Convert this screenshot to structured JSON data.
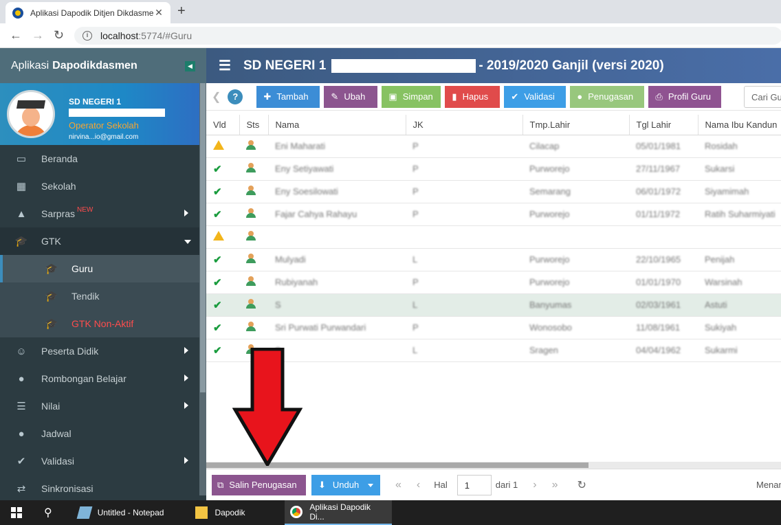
{
  "browser": {
    "tab_title": "Aplikasi Dapodik Ditjen Dikdasmen",
    "tab_close": "✕",
    "new_tab": "+",
    "url_host": "localhost",
    "url_path": ":5774/#Guru"
  },
  "sidebar": {
    "app_prefix": "Aplikasi",
    "app_name": "Dapodikdasmen",
    "profile": {
      "school": "SD NEGERI 1",
      "role": "Operator Sekolah",
      "email": "nirvina...io@gmail.com"
    },
    "items": [
      {
        "label": "Beranda",
        "icon": "desktop-icon"
      },
      {
        "label": "Sekolah",
        "icon": "building-icon"
      },
      {
        "label": "Sarpras",
        "badge": "NEW",
        "icon": "road-icon"
      },
      {
        "label": "GTK",
        "icon": "graduation-cap-icon"
      },
      {
        "label": "Guru",
        "icon": "graduation-cap-icon"
      },
      {
        "label": "Tendik",
        "icon": "graduation-cap-icon"
      },
      {
        "label": "GTK Non-Aktif",
        "icon": "graduation-cap-icon"
      },
      {
        "label": "Peserta Didik",
        "icon": "smile-icon"
      },
      {
        "label": "Rombongan Belajar",
        "icon": "users-icon"
      },
      {
        "label": "Nilai",
        "icon": "list-icon"
      },
      {
        "label": "Jadwal",
        "icon": "users-icon"
      },
      {
        "label": "Validasi",
        "icon": "check-icon"
      },
      {
        "label": "Sinkronisasi",
        "icon": "exchange-icon"
      }
    ]
  },
  "header": {
    "school": "SD NEGERI 1",
    "period": "- 2019/2020 Ganjil (versi 2020)"
  },
  "toolbar": {
    "help": "?",
    "tambah": "Tambah",
    "ubah": "Ubah",
    "simpan": "Simpan",
    "hapus": "Hapus",
    "validasi": "Validasi",
    "penugasan": "Penugasan",
    "profil_guru": "Profil Guru",
    "search_placeholder": "Cari Gu"
  },
  "table": {
    "headers": [
      "Vld",
      "Sts",
      "Nama",
      "JK",
      "Tmp.Lahir",
      "Tgl Lahir",
      "Nama Ibu Kandun"
    ],
    "rows": [
      {
        "vld": "warn",
        "nama": "Eni Maharati",
        "jk": "P",
        "tmp": "Cilacap",
        "tgl": "05/01/1981",
        "ibu": "Rosidah"
      },
      {
        "vld": "ok",
        "nama": "Eny Setiyawati",
        "jk": "P",
        "tmp": "Purworejo",
        "tgl": "27/11/1967",
        "ibu": "Sukarsi"
      },
      {
        "vld": "ok",
        "nama": "Eny Soesilowati",
        "jk": "P",
        "tmp": "Semarang",
        "tgl": "06/01/1972",
        "ibu": "Siyamimah"
      },
      {
        "vld": "ok",
        "nama": "Fajar Cahya Rahayu",
        "jk": "P",
        "tmp": "Purworejo",
        "tgl": "01/11/1972",
        "ibu": "Ratih Suharmiyati"
      },
      {
        "vld": "warn",
        "nama": "",
        "jk": "",
        "tmp": "",
        "tgl": "",
        "ibu": ""
      },
      {
        "vld": "ok",
        "nama": "Mulyadi",
        "jk": "L",
        "tmp": "Purworejo",
        "tgl": "22/10/1965",
        "ibu": "Penijah"
      },
      {
        "vld": "ok",
        "nama": "Rubiyanah",
        "jk": "P",
        "tmp": "Purworejo",
        "tgl": "01/01/1970",
        "ibu": "Warsinah"
      },
      {
        "vld": "ok",
        "nama": "S",
        "jk": "L",
        "tmp": "Banyumas",
        "tgl": "02/03/1961",
        "ibu": "Astuti"
      },
      {
        "vld": "ok",
        "nama": "Sri Purwati Purwandari",
        "jk": "P",
        "tmp": "Wonosobo",
        "tgl": "11/08/1961",
        "ibu": "Sukiyah"
      },
      {
        "vld": "ok",
        "nama": "S",
        "jk": "L",
        "tmp": "Sragen",
        "tgl": "04/04/1962",
        "ibu": "Sukarmi"
      }
    ]
  },
  "footer": {
    "salin": "Salin Penugasan",
    "unduh": "Unduh",
    "hal": "Hal",
    "page": "1",
    "dari": "dari 1",
    "menampilkan": "Menam"
  },
  "taskbar": {
    "items": [
      "Untitled - Notepad",
      "Dapodik",
      "Aplikasi Dapodik Di..."
    ]
  },
  "colors": {
    "sidebar_bg": "#2c3b41",
    "header_bg": "#4a6ea8",
    "accent_blue": "#3c8dbc",
    "arrow_red": "#e8141c"
  }
}
